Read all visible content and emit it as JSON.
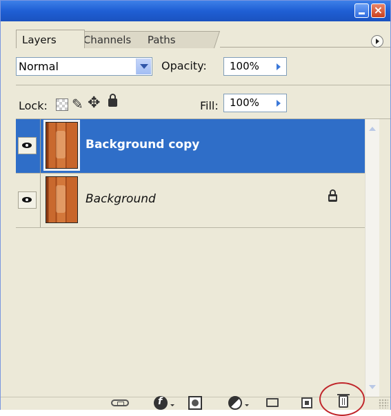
{
  "tabs": [
    {
      "label": "Layers",
      "active": true
    },
    {
      "label": "Channels",
      "active": false
    },
    {
      "label": "Paths",
      "active": false
    }
  ],
  "blend_mode": {
    "value": "Normal"
  },
  "opacity": {
    "label": "Opacity:",
    "value": "100%"
  },
  "lock": {
    "label": "Lock:"
  },
  "fill": {
    "label": "Fill:",
    "value": "100%"
  },
  "layers": [
    {
      "name": "Background copy",
      "selected": true,
      "visible": true,
      "locked": false
    },
    {
      "name": "Background",
      "selected": false,
      "visible": true,
      "locked": true
    }
  ],
  "colors": {
    "selection": "#2f6ec8",
    "titlebar": "#1f5fd4",
    "panel": "#ece9d8",
    "highlight": "#c0262b"
  },
  "toolbar_icons": [
    "link-icon",
    "fx-icon",
    "mask-icon",
    "adjustment-icon",
    "folder-icon",
    "new-layer-icon",
    "trash-icon"
  ]
}
